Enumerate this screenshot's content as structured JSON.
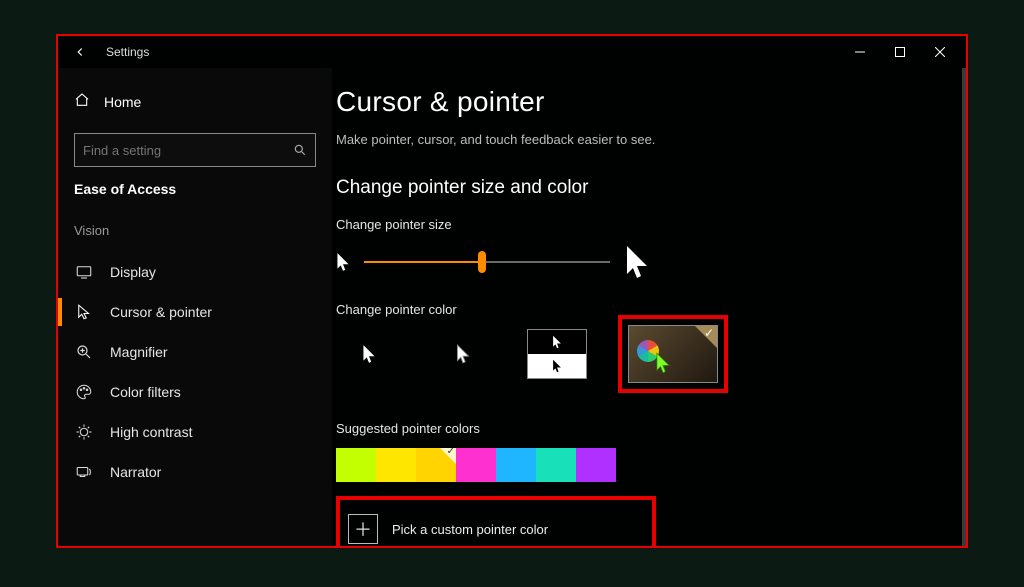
{
  "titlebar": {
    "title": "Settings"
  },
  "sidebar": {
    "home": "Home",
    "search_placeholder": "Find a setting",
    "section": "Ease of Access",
    "group": "Vision",
    "items": [
      {
        "label": "Display"
      },
      {
        "label": "Cursor & pointer"
      },
      {
        "label": "Magnifier"
      },
      {
        "label": "Color filters"
      },
      {
        "label": "High contrast"
      },
      {
        "label": "Narrator"
      }
    ]
  },
  "page": {
    "title": "Cursor & pointer",
    "description": "Make pointer, cursor, and touch feedback easier to see.",
    "section_heading": "Change pointer size and color",
    "size_label": "Change pointer size",
    "color_label": "Change pointer color",
    "suggested_label": "Suggested pointer colors",
    "custom_label": "Pick a custom pointer color"
  },
  "suggested_colors": [
    "#c3ff00",
    "#ffe600",
    "#ffd400",
    "#ff2fd0",
    "#1fb6ff",
    "#18e0b8",
    "#b030ff"
  ],
  "selected_suggested_index": 2,
  "pointer_color_selected": "custom"
}
